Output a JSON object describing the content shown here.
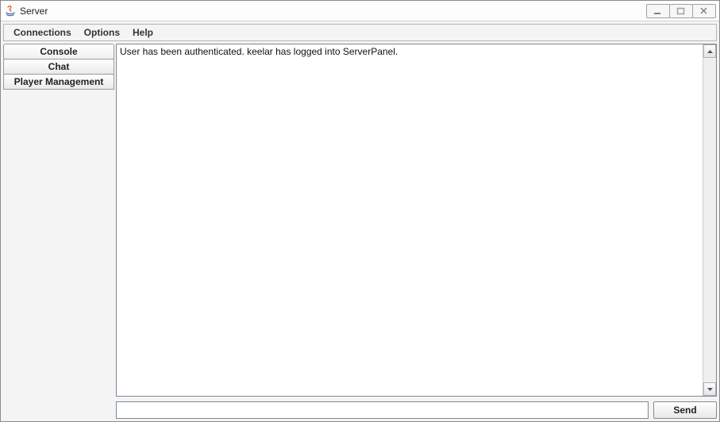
{
  "window": {
    "title": "Server",
    "icon": "java-icon"
  },
  "menubar": {
    "items": [
      "Connections",
      "Options",
      "Help"
    ]
  },
  "sidebar": {
    "tabs": [
      {
        "label": "Console",
        "selected": true
      },
      {
        "label": "Chat",
        "selected": false
      },
      {
        "label": "Player Management",
        "selected": false
      }
    ]
  },
  "console": {
    "log": "User has been authenticated. keelar has logged into ServerPanel."
  },
  "input": {
    "value": "",
    "placeholder": ""
  },
  "buttons": {
    "send": "Send"
  }
}
